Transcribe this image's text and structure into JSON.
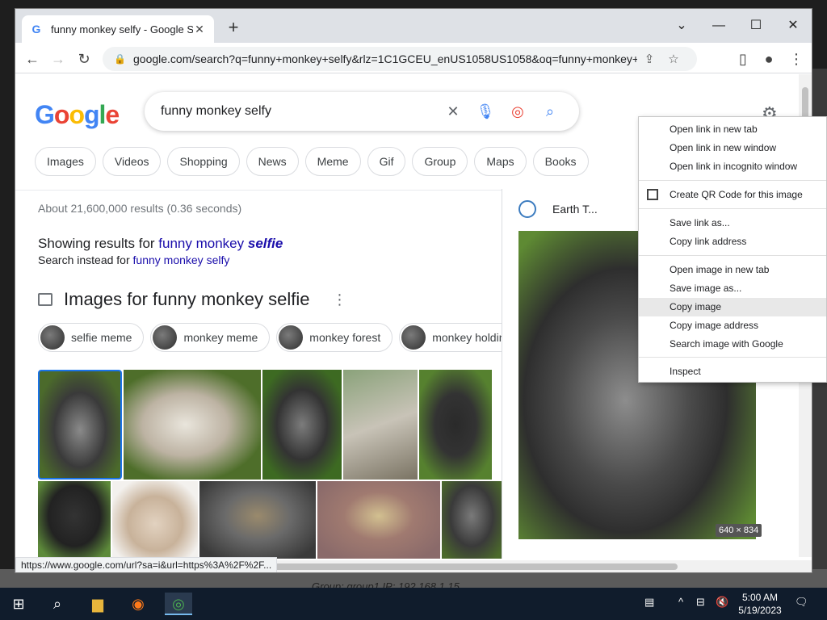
{
  "browser": {
    "tab_title": "funny monkey selfy - Google Sea",
    "url": "google.com/search?q=funny+monkey+selfy&rlz=1C1GCEU_enUS1058US1058&oq=funny+monkey+selfy...",
    "status_url": "https://www.google.com/url?sa=i&url=https%3A%2F%2F..."
  },
  "search": {
    "query": "funny monkey selfy",
    "chips": [
      "Images",
      "Videos",
      "Shopping",
      "News",
      "Meme",
      "Gif",
      "Group",
      "Maps",
      "Books"
    ],
    "stats": "About 21,600,000 results (0.36 seconds)",
    "showing_prefix": "Showing results for ",
    "showing_plain": "funny monkey ",
    "showing_bold": "selfie",
    "instead_prefix": "Search instead for ",
    "instead_link": "funny monkey selfy"
  },
  "images": {
    "heading": "Images for funny monkey selfie",
    "related": [
      "selfie meme",
      "monkey meme",
      "monkey forest",
      "monkey holding"
    ]
  },
  "preview": {
    "source": "Earth T...",
    "size": "640 × 834"
  },
  "context_menu": {
    "items": [
      "Open link in new tab",
      "Open link in new window",
      "Open link in incognito window",
      "Create QR Code for this image",
      "Save link as...",
      "Copy link address",
      "Open image in new tab",
      "Save image as...",
      "Copy image",
      "Copy image address",
      "Search image with Google",
      "Inspect"
    ]
  },
  "desktop": {
    "overlay_text": "Group: group1 IP: 192.168.1.15"
  },
  "taskbar": {
    "time": "5:00 AM",
    "date": "5/19/2023"
  },
  "colors": {
    "link": "#1a0dab",
    "taskbar": "#101c2c",
    "google_blue": "#4285f4"
  }
}
